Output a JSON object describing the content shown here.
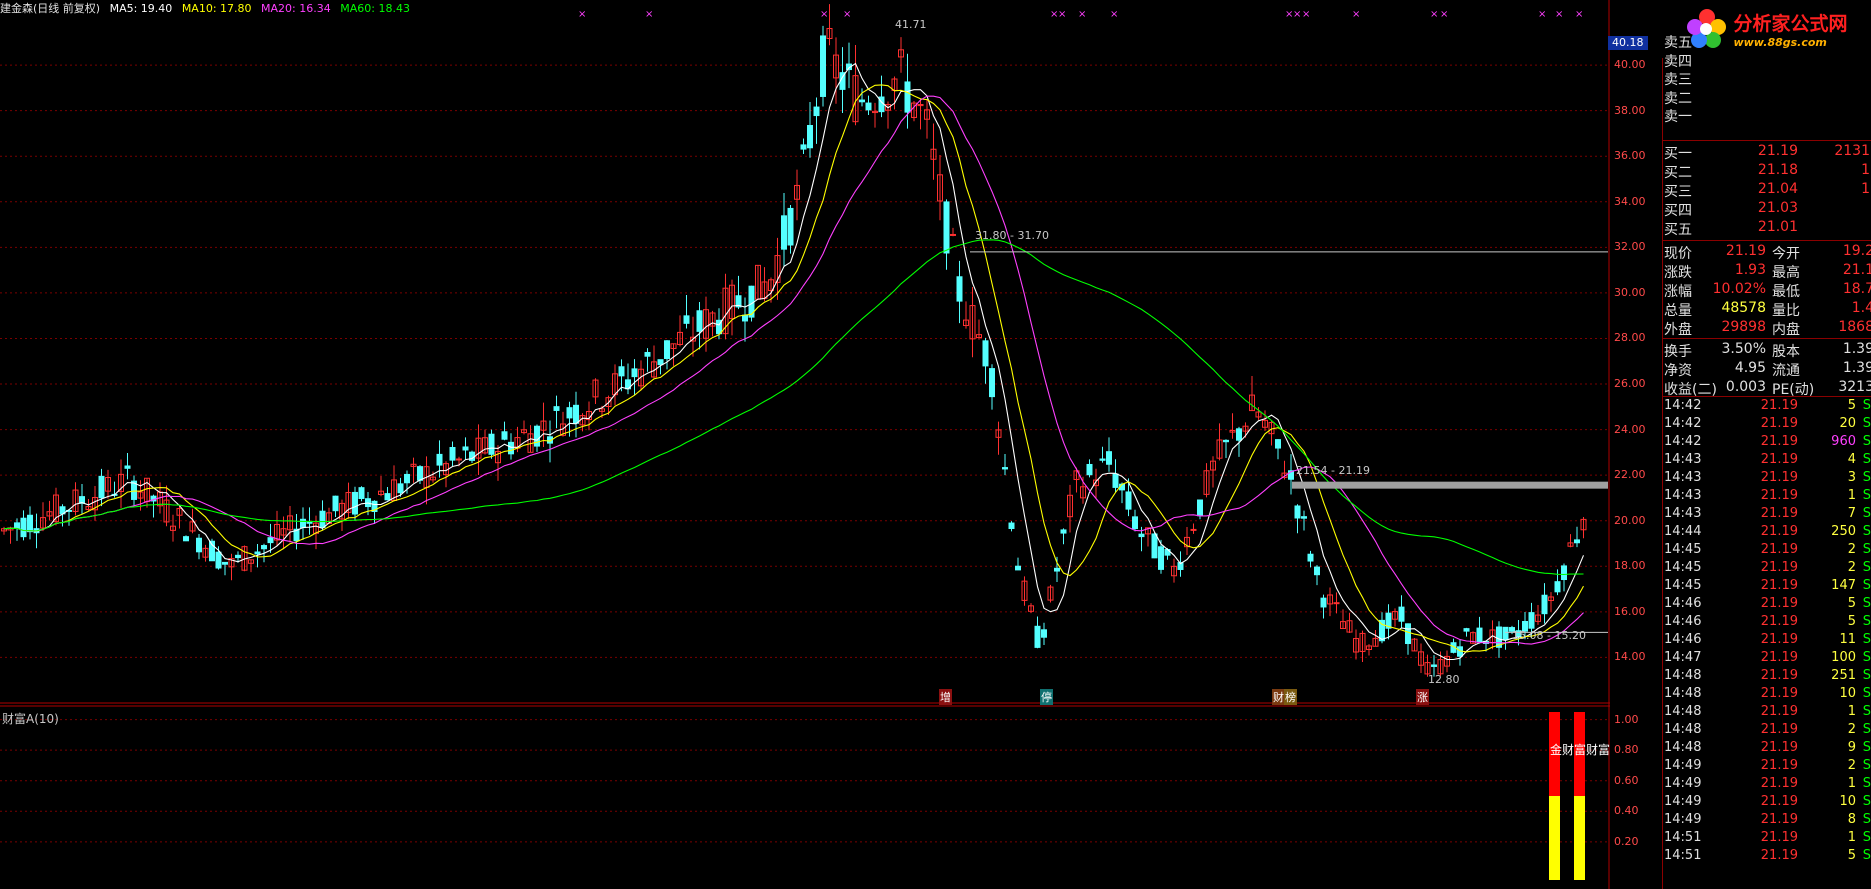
{
  "header": {
    "title": "建金森(日线 前复权)",
    "ma5": "MA5: 19.40",
    "ma10": "MA10: 17.80",
    "ma20": "MA20: 16.34",
    "ma60": "MA60: 18.43"
  },
  "colors": {
    "ma5": "#ffffff",
    "ma10": "#ffff00",
    "ma20": "#ff40ff",
    "ma60": "#00ff00",
    "up": "#ff3030",
    "down": "#54ffff",
    "grid": "#7a0000"
  },
  "cursor_price": "40.18",
  "price_axis": [
    "40.00",
    "38.00",
    "36.00",
    "34.00",
    "32.00",
    "30.00",
    "28.00",
    "26.00",
    "24.00",
    "22.00",
    "20.00",
    "18.00",
    "16.00",
    "14.00"
  ],
  "indicator_axis": [
    "1.00",
    "0.80",
    "0.60",
    "0.40",
    "0.20"
  ],
  "annotations": {
    "high": "41.71",
    "level1": "31.80 - 31.70",
    "level2": "21.54 - 21.19",
    "level3": "15.08 - 15.20",
    "low": "12.80"
  },
  "events": [
    "增",
    "停",
    "财",
    "榜",
    "涨"
  ],
  "sub_chart": {
    "title": "财富A(10)",
    "labels": "金财富财富",
    "bar_levels": [
      1.0,
      1.0
    ],
    "bar_split": [
      0.5,
      0.5
    ]
  },
  "chart_data": {
    "type": "candlestick",
    "y_range": [
      12.8,
      41.71
    ],
    "high_point": 41.71,
    "low_point": 12.8,
    "last_close": 21.19,
    "series": [
      {
        "name": "MA5",
        "last": 19.4
      },
      {
        "name": "MA10",
        "last": 17.8
      },
      {
        "name": "MA20",
        "last": 16.34
      },
      {
        "name": "MA60",
        "last": 18.43
      }
    ]
  },
  "logo": {
    "name": "分析家公式网",
    "url": "www.88gs.com"
  },
  "order_book": {
    "asks": [
      {
        "label": "卖五",
        "price": "",
        "vol": ""
      },
      {
        "label": "卖四",
        "price": "",
        "vol": ""
      },
      {
        "label": "卖三",
        "price": "",
        "vol": ""
      },
      {
        "label": "卖二",
        "price": "",
        "vol": ""
      },
      {
        "label": "卖一",
        "price": "",
        "vol": ""
      }
    ],
    "bids": [
      {
        "label": "买一",
        "price": "21.19",
        "vol": "2131"
      },
      {
        "label": "买二",
        "price": "21.18",
        "vol": "1"
      },
      {
        "label": "买三",
        "price": "21.04",
        "vol": "1"
      },
      {
        "label": "买四",
        "price": "21.03",
        "vol": ""
      },
      {
        "label": "买五",
        "price": "21.01",
        "vol": ""
      }
    ]
  },
  "quote": [
    {
      "l": "现价",
      "v": "21.19",
      "l2": "今开",
      "v2": "19.2"
    },
    {
      "l": "涨跌",
      "v": "1.93",
      "l2": "最高",
      "v2": "21.1"
    },
    {
      "l": "涨幅",
      "v": "10.02%",
      "l2": "最低",
      "v2": "18.7"
    },
    {
      "l": "总量",
      "v": "48578",
      "l2": "量比",
      "v2": "1.4"
    },
    {
      "l": "外盘",
      "v": "29898",
      "l2": "内盘",
      "v2": "1868"
    }
  ],
  "fundamentals": [
    {
      "l": "换手",
      "v": "3.50%",
      "l2": "股本",
      "v2": "1.39"
    },
    {
      "l": "净资",
      "v": "4.95",
      "l2": "流通",
      "v2": "1.39"
    },
    {
      "l": "收益(二)",
      "v": "0.003",
      "l2": "PE(动)",
      "v2": "3213"
    }
  ],
  "ticks": [
    {
      "t": "14:42",
      "p": "21.19",
      "v": "5",
      "s": "S"
    },
    {
      "t": "14:42",
      "p": "21.19",
      "v": "20",
      "s": "S"
    },
    {
      "t": "14:42",
      "p": "21.19",
      "v": "960",
      "s": "S"
    },
    {
      "t": "14:43",
      "p": "21.19",
      "v": "4",
      "s": "S"
    },
    {
      "t": "14:43",
      "p": "21.19",
      "v": "3",
      "s": "S"
    },
    {
      "t": "14:43",
      "p": "21.19",
      "v": "1",
      "s": "S"
    },
    {
      "t": "14:43",
      "p": "21.19",
      "v": "7",
      "s": "S"
    },
    {
      "t": "14:44",
      "p": "21.19",
      "v": "250",
      "s": "S"
    },
    {
      "t": "14:45",
      "p": "21.19",
      "v": "2",
      "s": "S"
    },
    {
      "t": "14:45",
      "p": "21.19",
      "v": "2",
      "s": "S"
    },
    {
      "t": "14:45",
      "p": "21.19",
      "v": "147",
      "s": "S"
    },
    {
      "t": "14:46",
      "p": "21.19",
      "v": "5",
      "s": "S"
    },
    {
      "t": "14:46",
      "p": "21.19",
      "v": "5",
      "s": "S"
    },
    {
      "t": "14:46",
      "p": "21.19",
      "v": "11",
      "s": "S"
    },
    {
      "t": "14:47",
      "p": "21.19",
      "v": "100",
      "s": "S"
    },
    {
      "t": "14:48",
      "p": "21.19",
      "v": "251",
      "s": "S"
    },
    {
      "t": "14:48",
      "p": "21.19",
      "v": "10",
      "s": "S"
    },
    {
      "t": "14:48",
      "p": "21.19",
      "v": "1",
      "s": "S"
    },
    {
      "t": "14:48",
      "p": "21.19",
      "v": "2",
      "s": "S"
    },
    {
      "t": "14:48",
      "p": "21.19",
      "v": "9",
      "s": "S"
    },
    {
      "t": "14:49",
      "p": "21.19",
      "v": "2",
      "s": "S"
    },
    {
      "t": "14:49",
      "p": "21.19",
      "v": "1",
      "s": "S"
    },
    {
      "t": "14:49",
      "p": "21.19",
      "v": "10",
      "s": "S"
    },
    {
      "t": "14:49",
      "p": "21.19",
      "v": "8",
      "s": "S"
    },
    {
      "t": "14:51",
      "p": "21.19",
      "v": "1",
      "s": "S"
    },
    {
      "t": "14:51",
      "p": "21.19",
      "v": "5",
      "s": "S"
    }
  ]
}
